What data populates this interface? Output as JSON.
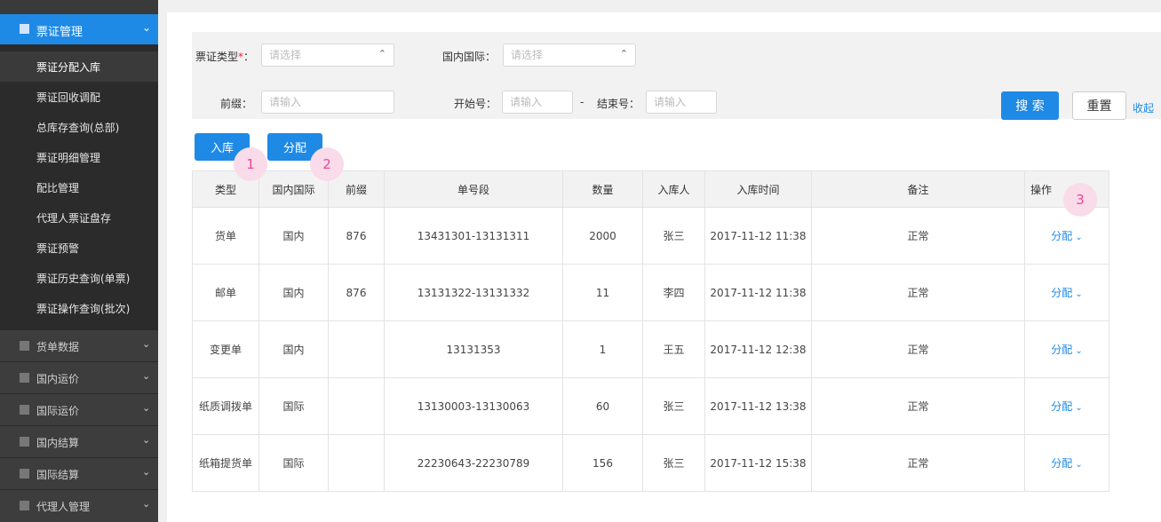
{
  "sidebar": {
    "active_group": "票证管理",
    "sub_items": [
      {
        "label": "票证分配入库"
      },
      {
        "label": "票证回收调配"
      },
      {
        "label": "总库存查询(总部)"
      },
      {
        "label": "票证明细管理"
      },
      {
        "label": "配比管理"
      },
      {
        "label": "代理人票证盘存"
      },
      {
        "label": "票证预警"
      },
      {
        "label": "票证历史查询(单票)"
      },
      {
        "label": "票证操作查询(批次)"
      }
    ],
    "groups": [
      {
        "label": "货单数据"
      },
      {
        "label": "国内运价"
      },
      {
        "label": "国际运价"
      },
      {
        "label": "国内结算"
      },
      {
        "label": "国际结算"
      },
      {
        "label": "代理人管理"
      }
    ]
  },
  "filters": {
    "ticket_type_label": "票证类型",
    "required_mark": "*",
    "ticket_type_colon": "：",
    "ticket_type_placeholder": "请选择",
    "domestic_label": "国内国际：",
    "domestic_placeholder": "请选择",
    "prefix_label": "前缀：",
    "prefix_placeholder": "请输入",
    "start_label": "开始号：",
    "start_placeholder": "请输入",
    "dash": "-",
    "end_label": "结束号：",
    "end_placeholder": "请输入"
  },
  "actions": {
    "search": "搜 索",
    "reset": "重置",
    "collapse": "收起",
    "inbound": "入库",
    "allocate": "分配"
  },
  "badges": [
    "1",
    "2",
    "3"
  ],
  "table": {
    "headers": [
      "类型",
      "国内国际",
      "前缀",
      "单号段",
      "数量",
      "入库人",
      "入库时间",
      "备注",
      "操作"
    ],
    "rows": [
      {
        "type": "货单",
        "region": "国内",
        "prefix": "876",
        "range": "13431301-13131311",
        "qty": "2000",
        "person": "张三",
        "time": "2017-11-12 11:38",
        "remark": "正常",
        "op": "分配"
      },
      {
        "type": "邮单",
        "region": "国内",
        "prefix": "876",
        "range": "13131322-13131332",
        "qty": "11",
        "person": "李四",
        "time": "2017-11-12 11:38",
        "remark": "正常",
        "op": "分配"
      },
      {
        "type": "变更单",
        "region": "国内",
        "prefix": "",
        "range": "13131353",
        "qty": "1",
        "person": "王五",
        "time": "2017-11-12 12:38",
        "remark": "正常",
        "op": "分配"
      },
      {
        "type": "纸质调拨单",
        "region": "国际",
        "prefix": "",
        "range": "13130003-13130063",
        "qty": "60",
        "person": "张三",
        "time": "2017-11-12 13:38",
        "remark": "正常",
        "op": "分配"
      },
      {
        "type": "纸箱提货单",
        "region": "国际",
        "prefix": "",
        "range": "22230643-22230789",
        "qty": "156",
        "person": "张三",
        "time": "2017-11-12 15:38",
        "remark": "正常",
        "op": "分配"
      }
    ]
  }
}
